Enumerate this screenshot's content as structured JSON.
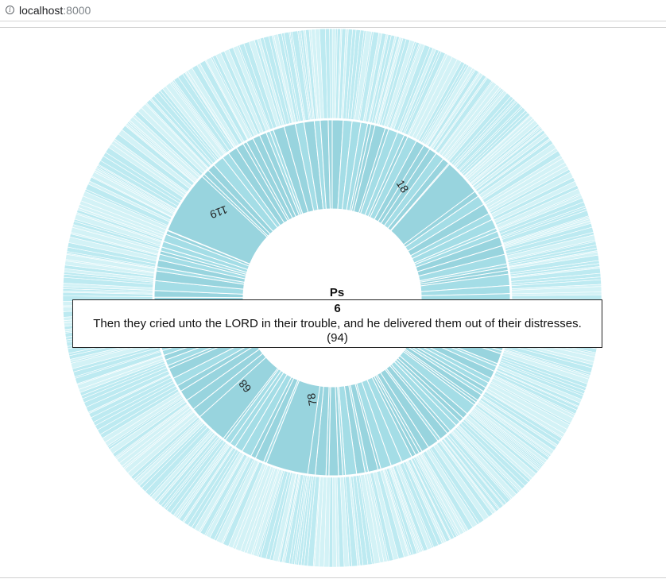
{
  "browser": {
    "url_host": "localhost",
    "url_port": ":8000"
  },
  "colors": {
    "inner_ring": "#a4dde6",
    "inner_ring_dark": "#98d4de",
    "outer_ring": "#bdeaf1",
    "outer_ring_light": "#d3f2f6",
    "separator": "#ffffff"
  },
  "center": {
    "book": "Ps"
  },
  "ring_labels": [
    "18",
    "119",
    "68",
    "78"
  ],
  "tooltip": {
    "verse_number": "6",
    "verse_text": "Then they cried unto the LORD in their trouble, and he delivered them out of their distresses.",
    "count": "(94)"
  }
}
